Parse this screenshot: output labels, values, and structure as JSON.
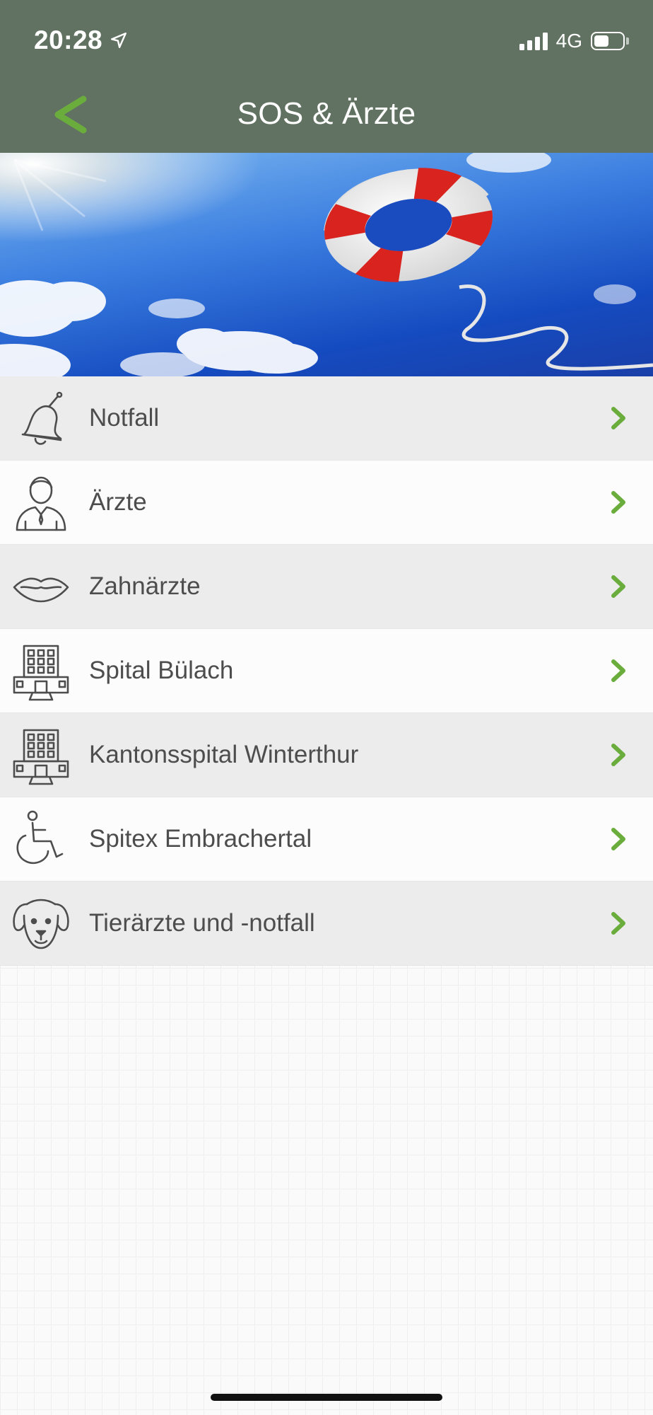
{
  "status_bar": {
    "time": "20:28",
    "network": "4G",
    "location_icon": "location-arrow-icon",
    "signal_icon": "signal-bars-icon",
    "battery_icon": "battery-icon"
  },
  "header": {
    "title": "SOS & Ärzte",
    "back_icon": "back-chevron-icon",
    "background_color": "#627262",
    "accent_color": "#6aad3d"
  },
  "hero": {
    "image": "lifebuoy-in-sky"
  },
  "menu": {
    "items": [
      {
        "label": "Notfall",
        "icon": "bell-icon"
      },
      {
        "label": "Ärzte",
        "icon": "doctor-icon"
      },
      {
        "label": "Zahnärzte",
        "icon": "lips-icon"
      },
      {
        "label": "Spital Bülach",
        "icon": "hospital-building-icon"
      },
      {
        "label": "Kantonsspital Winterthur",
        "icon": "hospital-building-icon"
      },
      {
        "label": "Spitex Embrachertal",
        "icon": "wheelchair-icon"
      },
      {
        "label": "Tierärzte und -notfall",
        "icon": "dog-icon"
      }
    ],
    "chevron_icon": "chevron-right-icon"
  }
}
